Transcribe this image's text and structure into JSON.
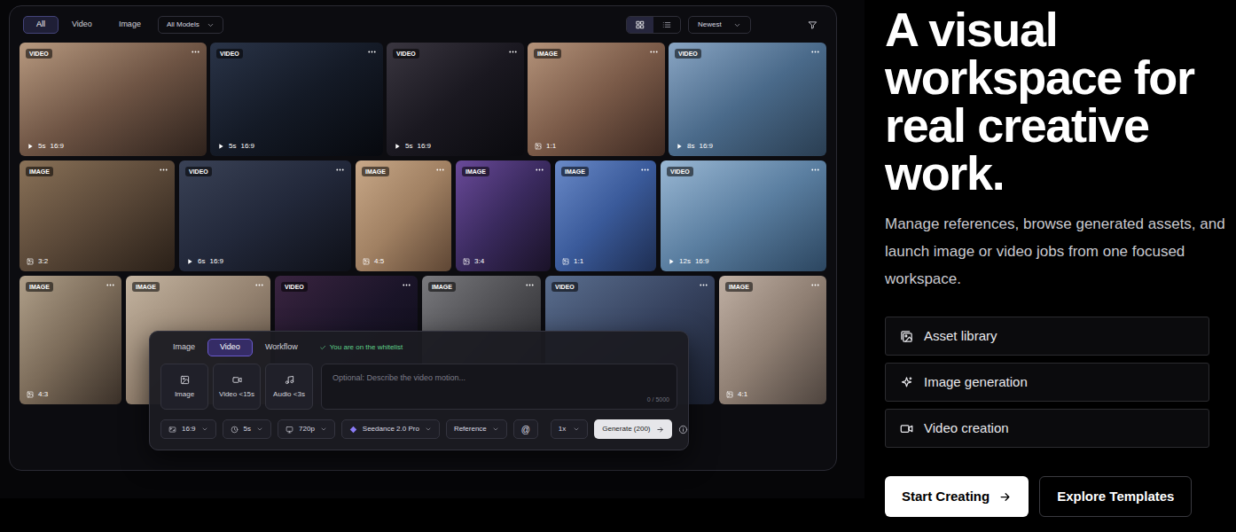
{
  "filters": {
    "tabs": [
      {
        "label": "All",
        "selected": true
      },
      {
        "label": "Video",
        "selected": false
      },
      {
        "label": "Image",
        "selected": false
      }
    ],
    "model": "All Models",
    "views": [
      {
        "kind": "grid",
        "selected": true
      },
      {
        "kind": "list",
        "selected": false
      }
    ],
    "sort": "Newest"
  },
  "gallery": {
    "rows": [
      [
        {
          "type": "VIDEO",
          "kind": "video",
          "duration": "5s",
          "ratio": "16:9"
        },
        {
          "type": "VIDEO",
          "kind": "video",
          "duration": "5s",
          "ratio": "16:9"
        },
        {
          "type": "VIDEO",
          "kind": "video",
          "duration": "5s",
          "ratio": "16:9"
        },
        {
          "type": "IMAGE",
          "kind": "image",
          "ratio": "1:1"
        },
        {
          "type": "VIDEO",
          "kind": "video",
          "duration": "8s",
          "ratio": "16:9"
        }
      ],
      [
        {
          "type": "IMAGE",
          "kind": "image",
          "ratio": "3:2"
        },
        {
          "type": "VIDEO",
          "kind": "video",
          "duration": "6s",
          "ratio": "16:9"
        },
        {
          "type": "IMAGE",
          "kind": "image",
          "ratio": "4:5"
        },
        {
          "type": "IMAGE",
          "kind": "image",
          "ratio": "3:4"
        },
        {
          "type": "IMAGE",
          "kind": "image",
          "ratio": "1:1"
        },
        {
          "type": "VIDEO",
          "kind": "video",
          "duration": "12s",
          "ratio": "16:9"
        }
      ],
      [
        {
          "type": "IMAGE",
          "kind": "image",
          "ratio": "4:3"
        },
        {
          "type": "IMAGE",
          "kind": "image"
        },
        {
          "type": "VIDEO",
          "kind": "video"
        },
        {
          "type": "IMAGE",
          "kind": "image"
        },
        {
          "type": "VIDEO",
          "kind": "video"
        },
        {
          "type": "IMAGE",
          "kind": "image",
          "ratio": "4:1"
        }
      ]
    ]
  },
  "generator": {
    "tabs": [
      {
        "label": "Image",
        "selected": false
      },
      {
        "label": "Video",
        "selected": true
      },
      {
        "label": "Workflow",
        "selected": false
      }
    ],
    "whitelist": "You are on the whitelist",
    "modes": [
      {
        "label": "Image",
        "kind": "image"
      },
      {
        "label": "Video <15s",
        "kind": "video"
      },
      {
        "label": "Audio <3s",
        "kind": "audio"
      }
    ],
    "prompt": {
      "placeholder": "Optional: Describe the video motion...",
      "counter": "0 / 5000"
    },
    "options": [
      {
        "label": "16:9",
        "kind": "ratio"
      },
      {
        "label": "5s",
        "kind": "duration"
      },
      {
        "label": "720p",
        "kind": "resolution"
      },
      {
        "label": "Seedance 2.0 Pro",
        "kind": "model"
      },
      {
        "label": "Reference",
        "kind": "reference"
      }
    ],
    "mention": "@",
    "count": "1x",
    "generate": "Generate (200)"
  },
  "hero": {
    "title": "A visual workspace for real creative work.",
    "description": "Manage references, browse generated assets, and launch image or video jobs from one focused workspace.",
    "features": [
      {
        "label": "Asset library",
        "kind": "library"
      },
      {
        "label": "Image generation",
        "kind": "sparkle"
      },
      {
        "label": "Video creation",
        "kind": "video"
      }
    ],
    "primary": "Start Creating",
    "secondary": "Explore Templates"
  }
}
